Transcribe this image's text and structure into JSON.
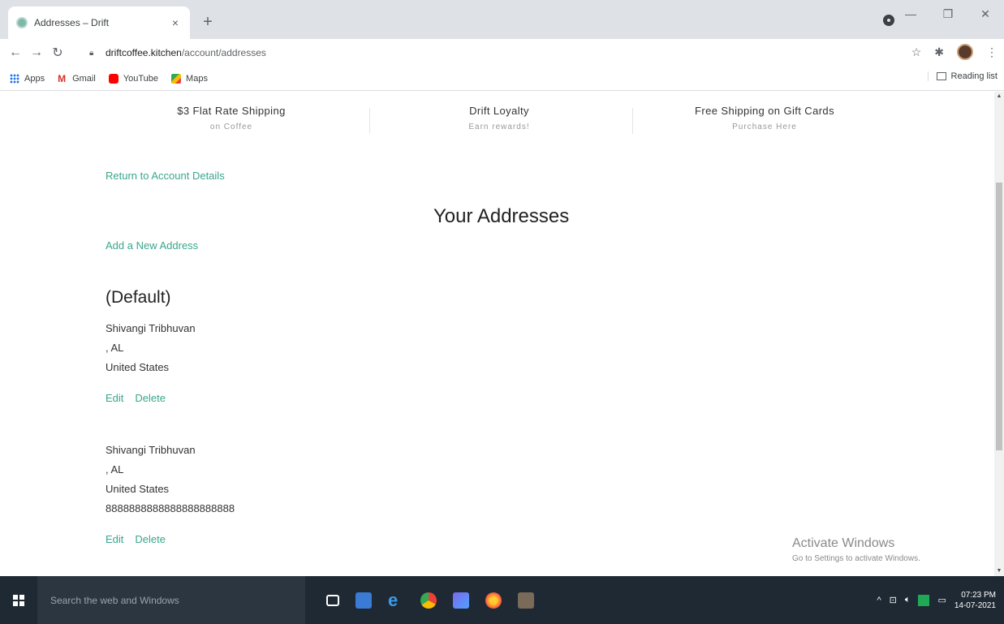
{
  "browser": {
    "tab_title": "Addresses – Drift",
    "tab_close": "×",
    "new_tab": "+",
    "url_host": "driftcoffee.kitchen",
    "url_path": "/account/addresses",
    "bookmarks": [
      {
        "label": "Apps"
      },
      {
        "label": "Gmail"
      },
      {
        "label": "YouTube"
      },
      {
        "label": "Maps"
      }
    ],
    "reading_list": "Reading list"
  },
  "promos": [
    {
      "title": "$3 Flat Rate Shipping",
      "subtitle": "on Coffee"
    },
    {
      "title": "Drift Loyalty",
      "subtitle": "Earn rewards!"
    },
    {
      "title": "Free Shipping on Gift Cards",
      "subtitle": "Purchase Here"
    }
  ],
  "page": {
    "return_link": "Return to Account Details",
    "title": "Your Addresses",
    "add_link": "Add a New Address",
    "default_label": "(Default)"
  },
  "addresses": [
    {
      "name": "Shivangi Tribhuvan",
      "region": ", AL",
      "country": "United States",
      "phone": "",
      "edit": "Edit",
      "delete": "Delete"
    },
    {
      "name": "Shivangi Tribhuvan",
      "region": ", AL",
      "country": "United States",
      "phone": "8888888888888888888888",
      "edit": "Edit",
      "delete": "Delete"
    }
  ],
  "watermark": {
    "title": "Activate Windows",
    "subtitle": "Go to Settings to activate Windows."
  },
  "taskbar": {
    "search_placeholder": "Search the web and Windows",
    "time": "07:23 PM",
    "date": "14-07-2021"
  },
  "colors": {
    "accent": "#3aa68c",
    "taskbar": "#1f2933"
  }
}
